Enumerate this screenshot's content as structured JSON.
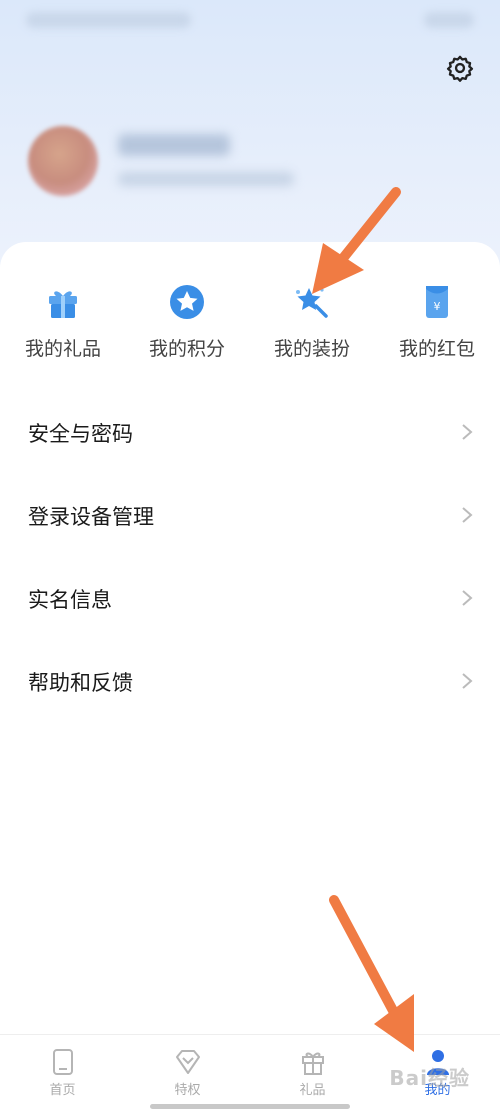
{
  "quick_actions": [
    {
      "label": "我的礼品",
      "icon": "gift-icon"
    },
    {
      "label": "我的积分",
      "icon": "star-badge-icon"
    },
    {
      "label": "我的装扮",
      "icon": "magic-wand-icon"
    },
    {
      "label": "我的红包",
      "icon": "red-packet-icon"
    }
  ],
  "menu": [
    {
      "label": "安全与密码"
    },
    {
      "label": "登录设备管理"
    },
    {
      "label": "实名信息"
    },
    {
      "label": "帮助和反馈"
    }
  ],
  "bottom_nav": [
    {
      "label": "首页",
      "icon": "home-icon",
      "active": false
    },
    {
      "label": "特权",
      "icon": "privilege-icon",
      "active": false
    },
    {
      "label": "礼品",
      "icon": "gift-icon",
      "active": false
    },
    {
      "label": "我的",
      "icon": "profile-icon",
      "active": true
    }
  ],
  "watermark": "Bai经验",
  "colors": {
    "accent": "#2f6fe4",
    "icon_blue": "#3a8ee6",
    "arrow": "#f07b43",
    "header_bg": "#dbe8fa"
  }
}
